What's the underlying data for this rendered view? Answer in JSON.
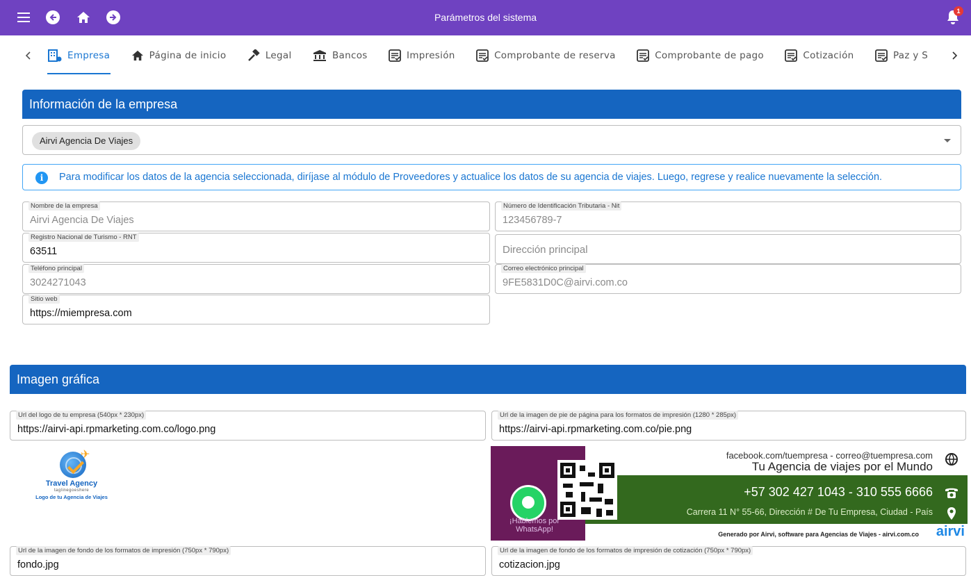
{
  "appbar": {
    "title": "Parámetros del sistema",
    "notifications_count": "1",
    "icons": [
      "menu-icon",
      "back-icon",
      "home-icon",
      "forward-icon",
      "bell-icon"
    ],
    "color": "#6f42c1"
  },
  "tabs": [
    {
      "label": "Empresa",
      "icon": "company-icon",
      "active": true
    },
    {
      "label": "Página de inicio",
      "icon": "home-icon"
    },
    {
      "label": "Legal",
      "icon": "gavel-icon"
    },
    {
      "label": "Bancos",
      "icon": "bank-icon"
    },
    {
      "label": "Impresión",
      "icon": "form-icon"
    },
    {
      "label": "Comprobante de reserva",
      "icon": "form-icon"
    },
    {
      "label": "Comprobante de pago",
      "icon": "form-icon"
    },
    {
      "label": "Cotización",
      "icon": "form-icon"
    },
    {
      "label": "Paz y S",
      "icon": "form-icon"
    }
  ],
  "company_section": {
    "title": "Información de la empresa",
    "selected_agency": "Airvi Agencia De Viajes",
    "info_text": "Para modificar los datos de la agencia seleccionada, diríjase al módulo de Proveedores y actualice los datos de su agencia de viajes. Luego, regrese y realice nuevamente la selección.",
    "fields": {
      "name": {
        "label": "Nombre de la empresa",
        "value": "Airvi Agencia De Viajes"
      },
      "nit": {
        "label": "Número de Identificación Tributaria - Nit",
        "value": "123456789-7"
      },
      "rnt": {
        "label": "Registro Nacional de Turismo - RNT",
        "value": "63511"
      },
      "address": {
        "label": "",
        "value": "",
        "placeholder": "Dirección principal"
      },
      "phone": {
        "label": "Teléfono principal",
        "value": "3024271043"
      },
      "email": {
        "label": "Correo electrónico principal",
        "value": "9FE5831D0C@airvi.com.co"
      },
      "website": {
        "label": "Sitio web",
        "value": "https://miempresa.com"
      }
    }
  },
  "graphics_section": {
    "title": "Imagen gráfica",
    "fields": {
      "logo_url": {
        "label": "Url del logo de tu empresa (540px * 230px)",
        "value": "https://airvi-api.rpmarketing.com.co/logo.png"
      },
      "footer_url": {
        "label": "Url de la imagen de pie de página para los formatos de impresión (1280 * 285px)",
        "value": "https://airvi-api.rpmarketing.com.co/pie.png"
      },
      "bg_url": {
        "label": "Url de la imagen de fondo de los formatos de impresión (750px * 790px)",
        "value": "fondo.jpg"
      },
      "quote_bg_url": {
        "label": "Url de la imagen de fondo de los formatos de impresión de cotización (750px * 790px)",
        "value": "cotizacion.jpg"
      }
    },
    "logo_preview": {
      "name": "Travel Agency",
      "tagline": "taglinegoeshere",
      "caption": "Logo de tu Agencia de Viajes"
    },
    "footer_preview": {
      "social": "facebook.com/tuempresa - correo@tuempresa.com",
      "slogan": "Tu Agencia de viajes por el Mundo",
      "phones": "+57 302 427 1043 - 310 555 6666",
      "address": "Carrera 11 N° 55-66, Dirección # De Tu Empresa, Ciudad - País",
      "whatsapp_label": "¡Hablemos por WhatsApp!",
      "generated_by": "Generado por Airvi, software para Agencias de Viajes - airvi.com.co",
      "brand": "airvi"
    }
  }
}
